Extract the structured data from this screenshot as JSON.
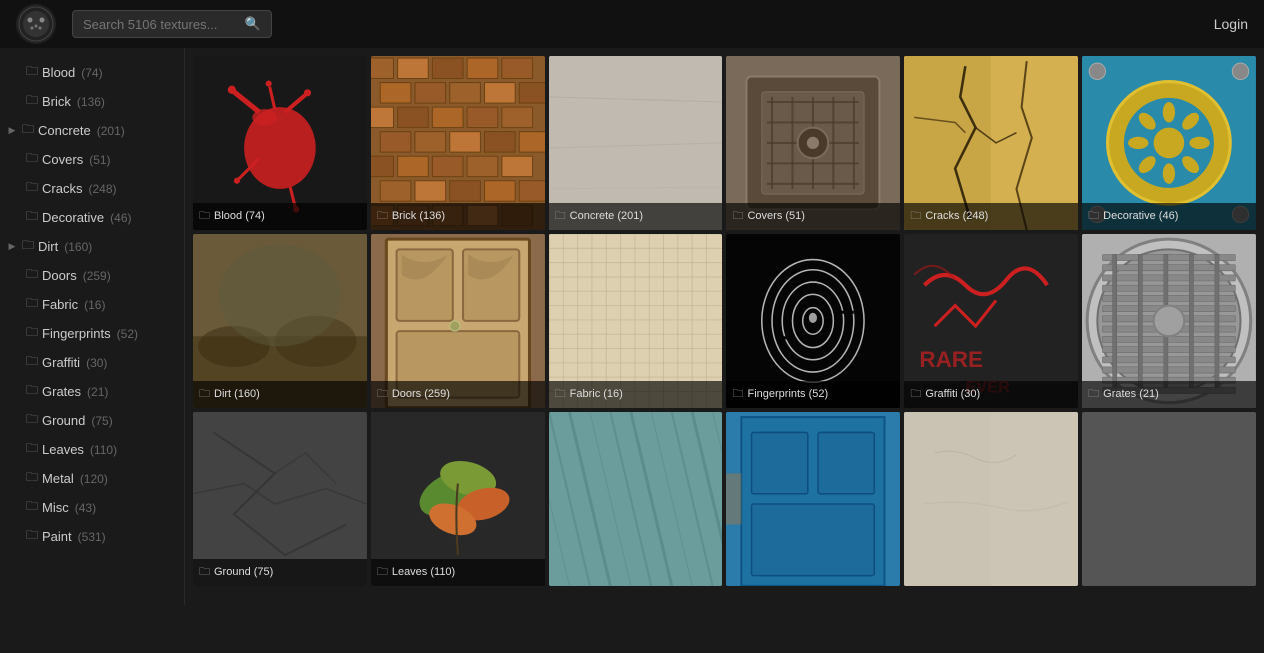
{
  "header": {
    "search_placeholder": "Search 5106 textures...",
    "login_label": "Login"
  },
  "sidebar": {
    "items": [
      {
        "id": "blood",
        "label": "Blood",
        "count": "(74)",
        "has_chevron": false
      },
      {
        "id": "brick",
        "label": "Brick",
        "count": "(136)",
        "has_chevron": false
      },
      {
        "id": "concrete",
        "label": "Concrete",
        "count": "(201)",
        "has_chevron": true
      },
      {
        "id": "covers",
        "label": "Covers",
        "count": "(51)",
        "has_chevron": false
      },
      {
        "id": "cracks",
        "label": "Cracks",
        "count": "(248)",
        "has_chevron": false
      },
      {
        "id": "decorative",
        "label": "Decorative",
        "count": "(46)",
        "has_chevron": false
      },
      {
        "id": "dirt",
        "label": "Dirt",
        "count": "(160)",
        "has_chevron": true
      },
      {
        "id": "doors",
        "label": "Doors",
        "count": "(259)",
        "has_chevron": false
      },
      {
        "id": "fabric",
        "label": "Fabric",
        "count": "(16)",
        "has_chevron": false
      },
      {
        "id": "fingerprints",
        "label": "Fingerprints",
        "count": "(52)",
        "has_chevron": false
      },
      {
        "id": "graffiti",
        "label": "Graffiti",
        "count": "(30)",
        "has_chevron": false
      },
      {
        "id": "grates",
        "label": "Grates",
        "count": "(21)",
        "has_chevron": false
      },
      {
        "id": "ground",
        "label": "Ground",
        "count": "(75)",
        "has_chevron": false
      },
      {
        "id": "leaves",
        "label": "Leaves",
        "count": "(110)",
        "has_chevron": false
      },
      {
        "id": "metal",
        "label": "Metal",
        "count": "(120)",
        "has_chevron": false
      },
      {
        "id": "misc",
        "label": "Misc",
        "count": "(43)",
        "has_chevron": false
      },
      {
        "id": "paint",
        "label": "Paint",
        "count": "(531)",
        "has_chevron": false
      }
    ]
  },
  "grid": {
    "items": [
      {
        "id": "blood",
        "label": "Blood",
        "count": "(74)",
        "tile_class": "tile-blood-special"
      },
      {
        "id": "brick",
        "label": "Brick",
        "count": "(136)",
        "tile_class": "tile-brick"
      },
      {
        "id": "concrete",
        "label": "Concrete",
        "count": "(201)",
        "tile_class": "tile-concrete"
      },
      {
        "id": "covers",
        "label": "Covers",
        "count": "(51)",
        "tile_class": "tile-covers"
      },
      {
        "id": "cracks",
        "label": "Cracks",
        "count": "(248)",
        "tile_class": "tile-cracks"
      },
      {
        "id": "decorative",
        "label": "Decorative",
        "count": "(46)",
        "tile_class": "tile-decorative"
      },
      {
        "id": "dirt",
        "label": "Dirt",
        "count": "(160)",
        "tile_class": "tile-dirt"
      },
      {
        "id": "doors",
        "label": "Doors",
        "count": "(259)",
        "tile_class": "tile-doors"
      },
      {
        "id": "fabric",
        "label": "Fabric",
        "count": "(16)",
        "tile_class": "tile-fabric"
      },
      {
        "id": "fingerprints",
        "label": "Fingerprints",
        "count": "(52)",
        "tile_class": "tile-fingerprints"
      },
      {
        "id": "graffiti",
        "label": "Graffiti",
        "count": "(30)",
        "tile_class": "tile-graffiti"
      },
      {
        "id": "grates",
        "label": "Grates",
        "count": "(21)",
        "tile_class": "tile-grates"
      },
      {
        "id": "ground",
        "label": "Ground",
        "count": "(75)",
        "tile_class": "tile-ground"
      },
      {
        "id": "leaves",
        "label": "Leaves",
        "count": "(110)",
        "tile_class": "tile-leaves"
      },
      {
        "id": "metal-scratch",
        "label": "",
        "count": "",
        "tile_class": "tile-metal-scratch"
      },
      {
        "id": "blue-door",
        "label": "",
        "count": "",
        "tile_class": "tile-blue-door"
      },
      {
        "id": "plaster",
        "label": "",
        "count": "",
        "tile_class": "tile-plaster"
      },
      {
        "id": "extra",
        "label": "",
        "count": "",
        "tile_class": "tile-concrete"
      }
    ]
  }
}
